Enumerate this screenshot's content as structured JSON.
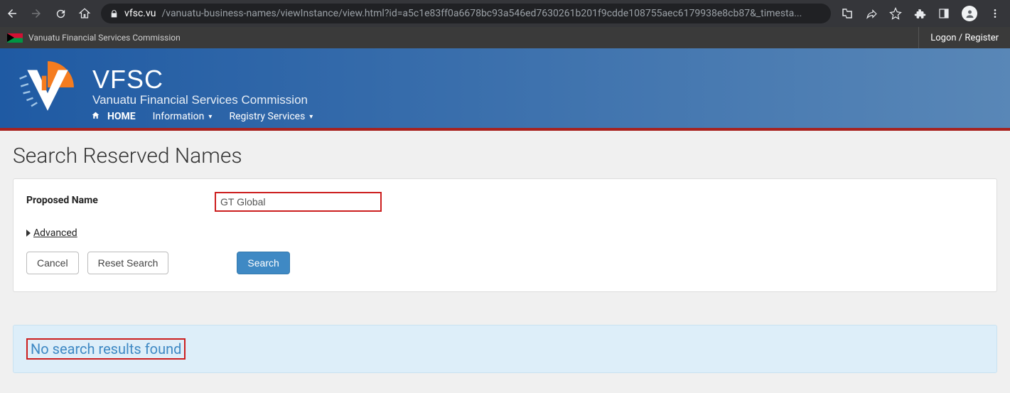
{
  "browser": {
    "url_host": "vfsc.vu",
    "url_path": "/vanuatu-business-names/viewInstance/view.html?id=a5c1e83ff0a6678bc93a546ed7630261b201f9cdde108755aec6179938e8cb87&_timesta..."
  },
  "gov_bar": {
    "title": "Vanuatu Financial Services Commission",
    "login": "Logon / Register"
  },
  "brand": {
    "acronym": "VFSC",
    "full": "Vanuatu Financial Services Commission"
  },
  "nav": {
    "home": "HOME",
    "information": "Information",
    "registry": "Registry Services"
  },
  "page": {
    "title": "Search Reserved Names",
    "label_proposed": "Proposed Name",
    "input_value": "GT Global",
    "advanced": "Advanced",
    "cancel": "Cancel",
    "reset": "Reset Search",
    "search": "Search",
    "no_results": "No search results found"
  }
}
